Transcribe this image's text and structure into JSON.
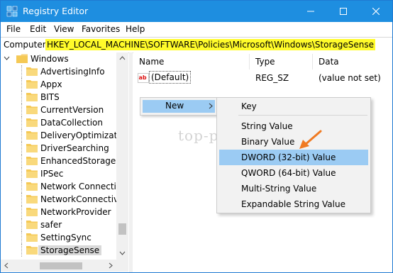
{
  "window": {
    "title": "Registry Editor",
    "accent": "#1e8ee0"
  },
  "menubar": {
    "items": [
      "File",
      "Edit",
      "View",
      "Favorites",
      "Help"
    ]
  },
  "address": {
    "prefix": "Computer\\",
    "path": "HKEY_LOCAL_MACHINE\\SOFTWARE\\Policies\\Microsoft\\Windows\\StorageSense",
    "highlight_color": "#fffb2a"
  },
  "tree": {
    "parent": "Windows",
    "items": [
      "AdvertisingInfo",
      "Appx",
      "BITS",
      "CurrentVersion",
      "DataCollection",
      "DeliveryOptimization",
      "DriverSearching",
      "EnhancedStorageDevices",
      "IPSec",
      "Network Connections",
      "NetworkConnectivityStatusIndicator",
      "NetworkProvider",
      "safer",
      "SettingSync",
      "StorageSense"
    ],
    "selected": "StorageSense"
  },
  "list": {
    "columns": [
      "Name",
      "Type",
      "Data"
    ],
    "rows": [
      {
        "name": "(Default)",
        "type": "REG_SZ",
        "data": "(value not set)",
        "icon": "ab-string-icon"
      }
    ]
  },
  "watermark": "top-password.com",
  "context_menu": {
    "new_label": "New",
    "submenu": [
      "Key",
      "String Value",
      "Binary Value",
      "DWORD (32-bit) Value",
      "QWORD (64-bit) Value",
      "Multi-String Value",
      "Expandable String Value"
    ],
    "highlighted": "DWORD (32-bit) Value",
    "highlight_color": "#9bcbf3"
  },
  "annotation": {
    "arrow_color": "#f07a22"
  }
}
